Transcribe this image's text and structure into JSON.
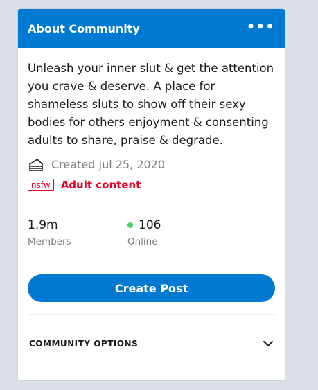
{
  "header": {
    "title": "About Community",
    "more_icon": "more-horizontal-icon"
  },
  "description": "Unleash your inner slut & get the attention you crave & deserve. A place for shameless sluts to show off their sexy bodies for others enjoyment & consenting adults to share, praise & degrade.",
  "created": {
    "icon": "cake-icon",
    "text": "Created Jul 25, 2020"
  },
  "nsfw": {
    "badge": "nsfw",
    "label": "Adult content"
  },
  "stats": {
    "members": {
      "value": "1.9m",
      "label": "Members"
    },
    "online": {
      "value": "106",
      "label": "Online"
    }
  },
  "create_post": {
    "label": "Create Post"
  },
  "options": {
    "label": "COMMUNITY OPTIONS",
    "icon": "chevron-down-icon"
  },
  "colors": {
    "accent": "#0079d3",
    "nsfw": "#ea0027",
    "online": "#46d160"
  }
}
